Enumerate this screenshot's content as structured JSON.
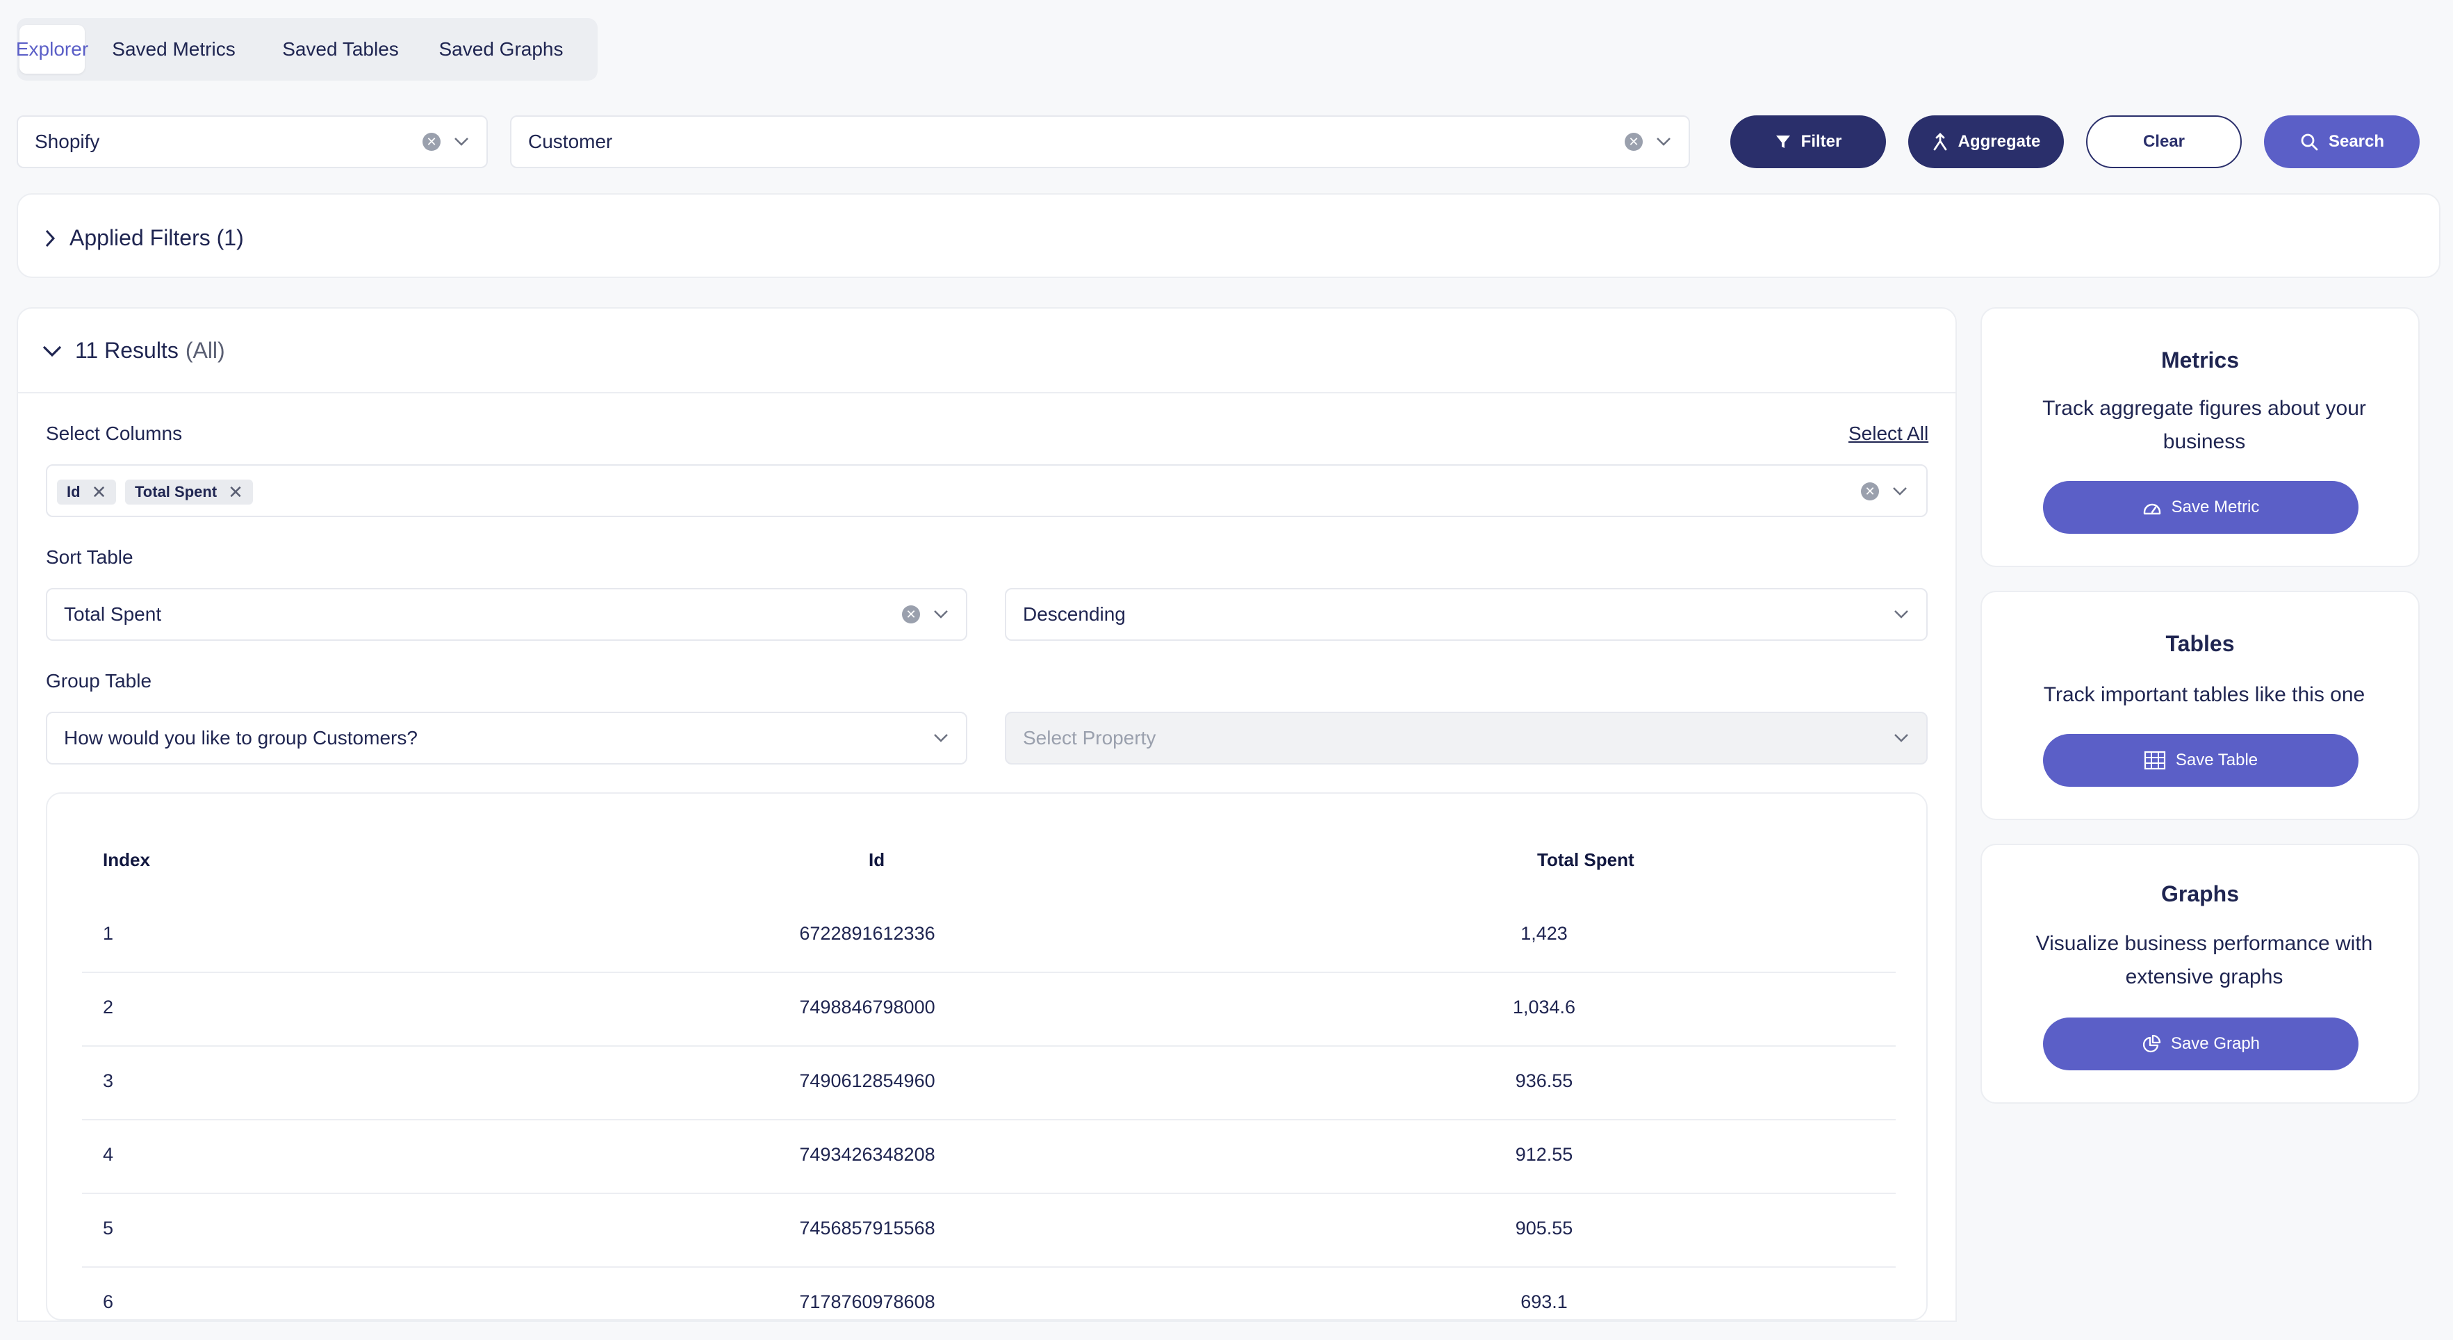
{
  "tabs": [
    {
      "label": "Explorer",
      "active": true
    },
    {
      "label": "Saved Metrics",
      "active": false
    },
    {
      "label": "Saved Tables",
      "active": false
    },
    {
      "label": "Saved Graphs",
      "active": false
    }
  ],
  "query": {
    "source": "Shopify",
    "entity": "Customer",
    "filter_label": "Filter",
    "aggregate_label": "Aggregate",
    "clear_label": "Clear",
    "search_label": "Search"
  },
  "applied_filters": {
    "label": "Applied Filters (1)"
  },
  "results": {
    "count_label": "11 Results",
    "scope_label": "(All)",
    "select_columns_label": "Select Columns",
    "select_all_label": "Select All",
    "selected_columns": [
      "Id",
      "Total Spent"
    ],
    "sort_label": "Sort Table",
    "sort_by": "Total Spent",
    "sort_order": "Descending",
    "group_label": "Group Table",
    "group_placeholder": "How would you like to group Customers?",
    "property_placeholder": "Select Property"
  },
  "table": {
    "headers": [
      "Index",
      "Id",
      "Total Spent"
    ],
    "rows": [
      {
        "index": "1",
        "id": "6722891612336",
        "total": "1,423"
      },
      {
        "index": "2",
        "id": "7498846798000",
        "total": "1,034.6"
      },
      {
        "index": "3",
        "id": "7490612854960",
        "total": "936.55"
      },
      {
        "index": "4",
        "id": "7493426348208",
        "total": "912.55"
      },
      {
        "index": "5",
        "id": "7456857915568",
        "total": "905.55"
      },
      {
        "index": "6",
        "id": "7178760978608",
        "total": "693.1"
      }
    ]
  },
  "side": {
    "metrics": {
      "title": "Metrics",
      "desc": "Track aggregate figures about your business",
      "button": "Save Metric"
    },
    "tables": {
      "title": "Tables",
      "desc": "Track important tables like this one",
      "button": "Save Table"
    },
    "graphs": {
      "title": "Graphs",
      "desc": "Visualize business performance with extensive graphs",
      "button": "Save Graph"
    }
  },
  "colors": {
    "primary": "#5b5fc7",
    "dark": "#2a2f6b",
    "text": "#1f2551"
  }
}
